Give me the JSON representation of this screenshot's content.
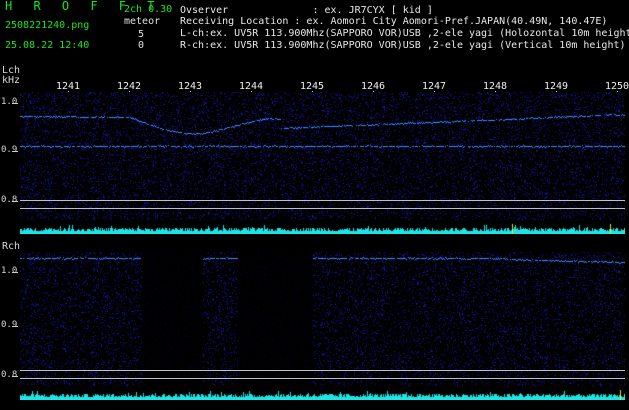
{
  "header": {
    "logo": "H R O F F T",
    "filename": "2508221240.png",
    "datetime": "25.08.22 12:40",
    "version": "2ch 0.30",
    "meteor_label": "meteor",
    "count_l": "5",
    "count_r": "0"
  },
  "info": {
    "observer": "Ovserver              : ex. JR7CYX [ kid ]",
    "location": "Receiving Location : ex. Aomori City Aomori-Pref.JAPAN(40.49N, 140.47E)",
    "lch": "L-ch:ex. UV5R 113.900Mhz(SAPPORO VOR)USB ,2-ele yagi (Holozontal 10m height)",
    "rch": "R-ch:ex. UV5R 113.900Mhz(SAPPORO VOR)USB ,2-ele yagi (Vertical 10m height)"
  },
  "lch": {
    "label_ch": "Lch",
    "label_unit": "kHz",
    "axis": [
      "1.0",
      "0.9",
      "0.8"
    ]
  },
  "rch": {
    "label_ch": "Rch",
    "axis": [
      "1.0",
      "0.9",
      "0.8"
    ]
  },
  "minute_ticks": [
    "1241",
    "1242",
    "1243",
    "1244",
    "1245",
    "1246",
    "1247",
    "1248",
    "1249",
    "1250"
  ],
  "colors": {
    "background": "#000000",
    "noise": "#1a1aa0",
    "trace": "#3c8cff",
    "level_bar": "#19e6e6",
    "header_green": "#19e619"
  }
}
